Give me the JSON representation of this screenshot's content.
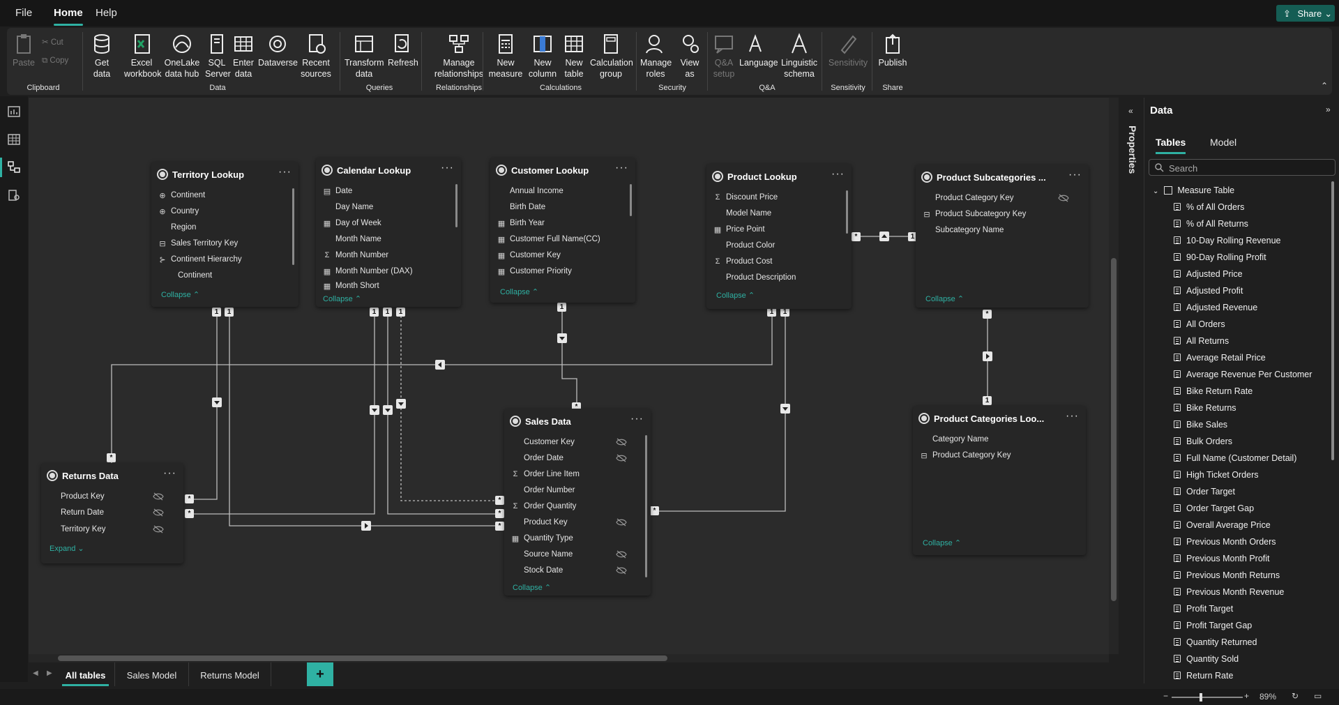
{
  "menu": {
    "file": "File",
    "home": "Home",
    "help": "Help",
    "share": "Share"
  },
  "ribbon": {
    "paste": "Paste",
    "cut": "Cut",
    "copy": "Copy",
    "get_data": "Get data",
    "excel": "Excel workbook",
    "onelake": "OneLake data hub",
    "sql": "SQL Server",
    "enter": "Enter data",
    "dataverse": "Dataverse",
    "recent": "Recent sources",
    "transform": "Transform data",
    "refresh": "Refresh",
    "manage_rel": "Manage relationships",
    "new_measure": "New measure",
    "new_column": "New column",
    "new_table": "New table",
    "calc_group": "Calculation group",
    "manage_roles": "Manage roles",
    "view_as": "View as",
    "qa_setup": "Q&A setup",
    "language": "Language",
    "ling": "Linguistic schema",
    "sensitivity": "Sensitivity",
    "publish": "Publish",
    "groups": {
      "clipboard": "Clipboard",
      "data": "Data",
      "queries": "Queries",
      "relationships": "Relationships",
      "calculations": "Calculations",
      "security": "Security",
      "qa": "Q&A",
      "sensitivity": "Sensitivity",
      "share": "Share"
    }
  },
  "tables": {
    "territory": {
      "title": "Territory Lookup",
      "fields": [
        "Continent",
        "Country",
        "Region",
        "Sales Territory Key",
        "Continent Hierarchy",
        "Continent"
      ],
      "footer": "Collapse"
    },
    "calendar": {
      "title": "Calendar Lookup",
      "fields": [
        "Date",
        "Day Name",
        "Day of Week",
        "Month Name",
        "Month Number",
        "Month Number (DAX)",
        "Month Short"
      ],
      "footer": "Collapse"
    },
    "customer": {
      "title": "Customer Lookup",
      "fields": [
        "Annual Income",
        "Birth Date",
        "Birth Year",
        "Customer Full Name(CC)",
        "Customer Key",
        "Customer Priority"
      ],
      "footer": "Collapse"
    },
    "product": {
      "title": "Product Lookup",
      "fields": [
        "Discount Price",
        "Model Name",
        "Price Point",
        "Product Color",
        "Product Cost",
        "Product Description"
      ],
      "footer": "Collapse"
    },
    "subcat": {
      "title": "Product Subcategories ...",
      "fields": [
        "Product Category Key",
        "Product Subcategory Key",
        "Subcategory Name"
      ],
      "footer": "Collapse"
    },
    "sales": {
      "title": "Sales Data",
      "fields": [
        "Customer Key",
        "Order Date",
        "Order Line Item",
        "Order Number",
        "Order Quantity",
        "Product Key",
        "Quantity Type",
        "Source Name",
        "Stock Date"
      ],
      "footer": "Collapse"
    },
    "returns": {
      "title": "Returns Data",
      "fields": [
        "Product Key",
        "Return Date",
        "Territory Key"
      ],
      "footer": "Expand"
    },
    "categories": {
      "title": "Product Categories Loo...",
      "fields": [
        "Category Name",
        "Product Category Key"
      ],
      "footer": "Collapse"
    }
  },
  "badges": {
    "one": "1",
    "many": "*"
  },
  "tabs": [
    "All tables",
    "Sales Model",
    "Returns Model"
  ],
  "add_tab": "+",
  "zoom": "89%",
  "properties_label": "Properties",
  "datapane": {
    "title": "Data",
    "tab_tables": "Tables",
    "tab_model": "Model",
    "search_placeholder": "Search",
    "measure_table": "Measure Table",
    "measures": [
      "% of All Orders",
      "% of All Returns",
      "10-Day Rolling Revenue",
      "90-Day Rolling Profit",
      "Adjusted Price",
      "Adjusted Profit",
      "Adjusted Revenue",
      "All Orders",
      "All Returns",
      "Average Retail Price",
      "Average Revenue Per Customer",
      "Bike Return Rate",
      "Bike Returns",
      "Bike Sales",
      "Bulk Orders",
      "Full Name (Customer Detail)",
      "High Ticket Orders",
      "Order Target",
      "Order Target Gap",
      "Overall Average Price",
      "Previous Month Orders",
      "Previous Month Profit",
      "Previous Month Returns",
      "Previous Month Revenue",
      "Profit Target",
      "Profit Target Gap",
      "Quantity Returned",
      "Quantity Sold",
      "Return Rate"
    ]
  }
}
